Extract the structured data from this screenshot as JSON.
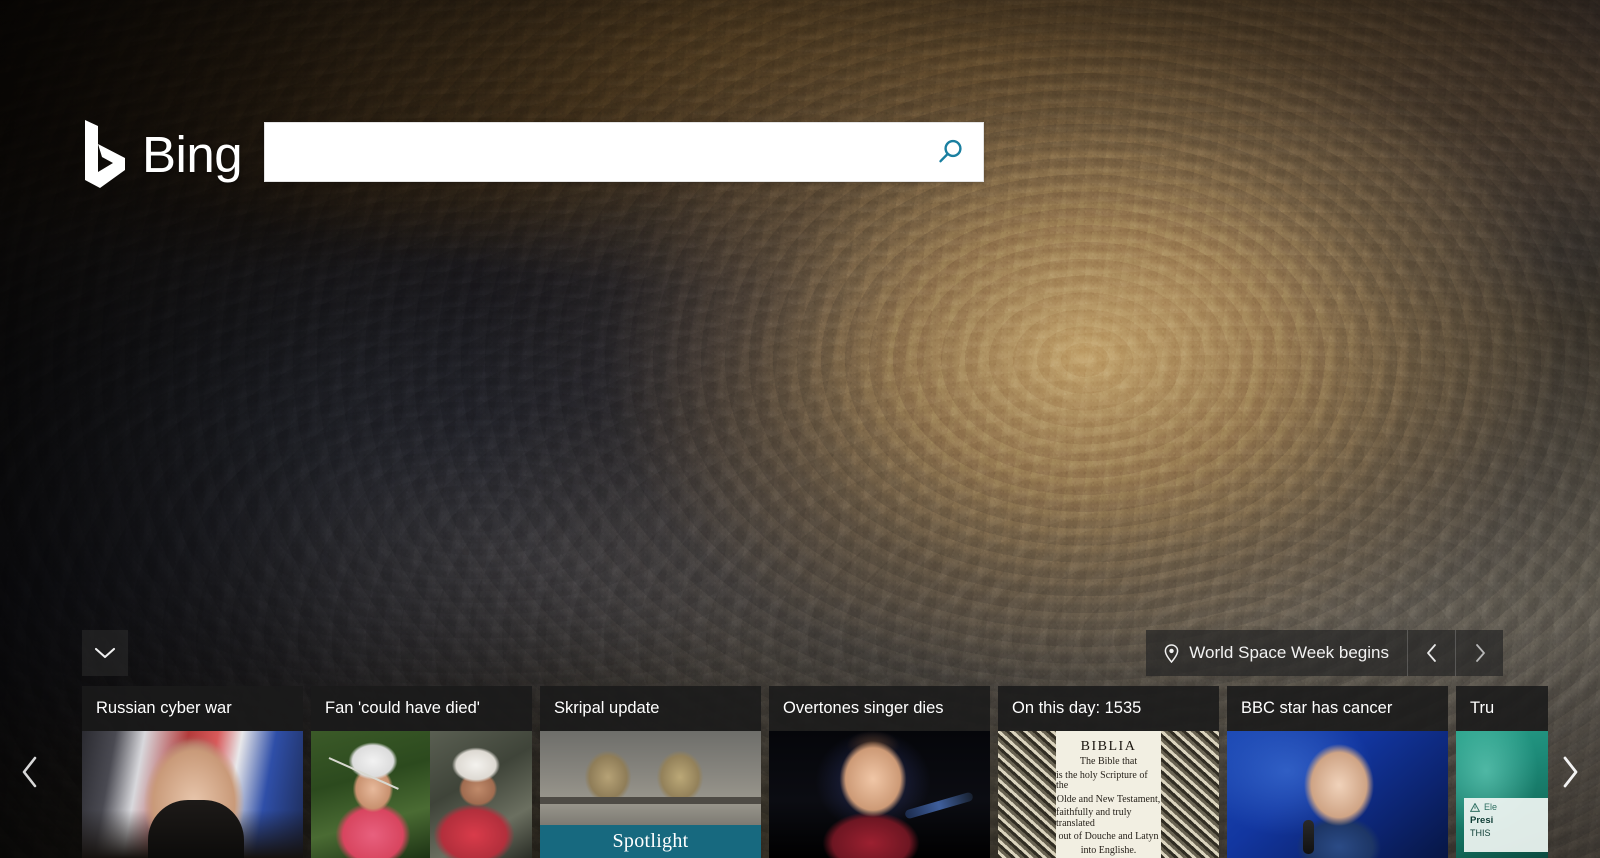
{
  "brand": {
    "name": "Bing",
    "logo_icon": "bing-b-logo"
  },
  "search": {
    "value": "",
    "placeholder": "",
    "button_icon": "search-magnifier-icon",
    "button_color": "#1a7fa0"
  },
  "expand": {
    "icon": "chevron-down-icon"
  },
  "infobar": {
    "pin_icon": "location-pin-icon",
    "label": "World Space Week begins",
    "prev_icon": "chevron-left-icon",
    "next_icon": "chevron-right-icon"
  },
  "carousel": {
    "prev_icon": "chevron-left-icon",
    "next_icon": "chevron-right-icon",
    "cards": [
      {
        "title": "Russian cyber war",
        "badge": ""
      },
      {
        "title": "Fan 'could have died'",
        "badge": ""
      },
      {
        "title": "Skripal update",
        "badge": "Spotlight"
      },
      {
        "title": "Overtones singer dies",
        "badge": ""
      },
      {
        "title": "On this day: 1535",
        "badge": ""
      },
      {
        "title": "BBC star has cancer",
        "badge": ""
      },
      {
        "title": "Tru",
        "badge": ""
      }
    ]
  },
  "bible_art": {
    "title": "BIBLIA",
    "line1": "The Bible that",
    "line2": "is the holy Scripture of the",
    "line3": "Olde and New Testament,",
    "line4": "faithfully and truly translated",
    "line5": "out of Douche and Latyn",
    "line6": "into Englishe."
  },
  "trump_art": {
    "alert_icon": "warning-triangle-icon",
    "alert_label": "Ele",
    "line1": "Presi",
    "line2": "THIS"
  },
  "colors": {
    "spotlight_teal": "#17697f",
    "card_header": "rgba(26,26,26,0.88)",
    "infobar_bg": "rgba(38,38,38,0.72)"
  }
}
